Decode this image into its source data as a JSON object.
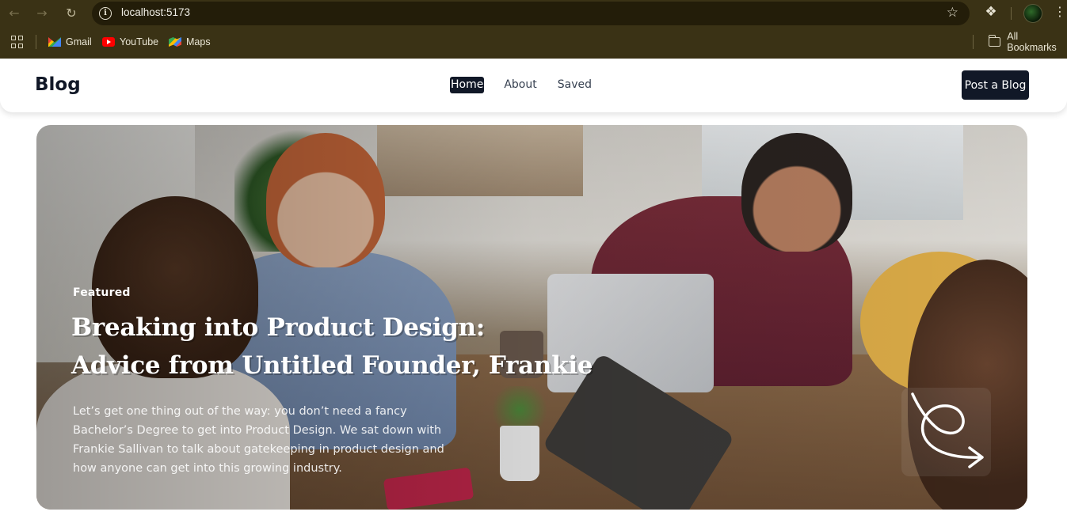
{
  "browser": {
    "url": "localhost:5173",
    "bookmarks": [
      {
        "label": "Gmail",
        "icon": "gmail-icon"
      },
      {
        "label": "YouTube",
        "icon": "youtube-icon"
      },
      {
        "label": "Maps",
        "icon": "maps-icon"
      }
    ],
    "all_bookmarks_label": "All Bookmarks"
  },
  "header": {
    "brand": "Blog",
    "nav": [
      {
        "label": "Home",
        "active": true
      },
      {
        "label": "About",
        "active": false
      },
      {
        "label": "Saved",
        "active": false
      }
    ],
    "post_button": "Post a Blog"
  },
  "hero": {
    "tag": "Featured",
    "title_line1": "Breaking into Product Design:",
    "title_line2": "Advice from Untitled Founder, Frankie",
    "excerpt": "Let’s get one thing out of the way: you don’t need a fancy Bachelor’s Degree to get into Product Design. We sat down with Frankie Sallivan to talk about gatekeeping in product design and how anyone can get into this growing industry.",
    "arrow_icon": "curly-arrow-icon"
  },
  "colors": {
    "chrome_bg": "#3a3215",
    "primary_dark": "#111827",
    "white": "#ffffff"
  }
}
